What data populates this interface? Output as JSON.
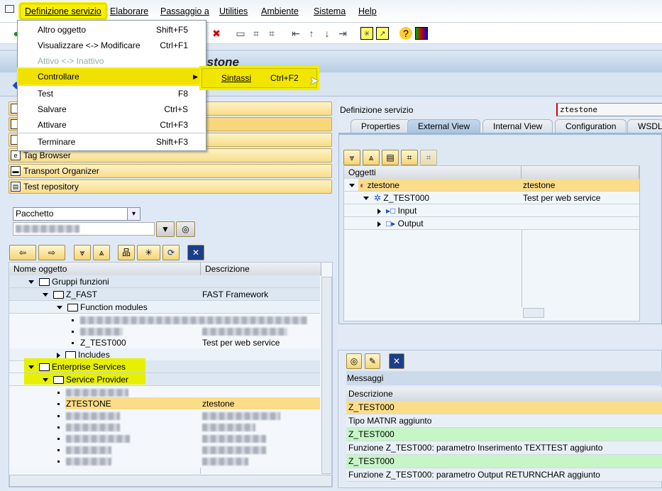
{
  "menubar": {
    "items": [
      "Definizione servizio",
      "Elaborare",
      "Passaggio a",
      "Utilities",
      "Ambiente",
      "Sistema",
      "Help"
    ]
  },
  "title": "ztestone",
  "dropdown": {
    "items": [
      {
        "label": "Altro oggetto",
        "shortcut": "Shift+F5",
        "enabled": true
      },
      {
        "label": "Visualizzare <-> Modificare",
        "shortcut": "Ctrl+F1",
        "enabled": true
      },
      {
        "label": "Attivo <-> Inattivo",
        "shortcut": "",
        "enabled": false
      },
      {
        "label": "Controllare",
        "shortcut": "",
        "enabled": true,
        "submenu": true
      },
      {
        "label": "Test",
        "shortcut": "F8",
        "enabled": true
      },
      {
        "label": "Salvare",
        "shortcut": "Ctrl+S",
        "enabled": true
      },
      {
        "label": "Attivare",
        "shortcut": "Ctrl+F3",
        "enabled": true
      },
      {
        "label": "Terminare",
        "shortcut": "Shift+F3",
        "enabled": true
      }
    ],
    "submenu": {
      "label": "Sintassi",
      "shortcut": "Ctrl+F2"
    }
  },
  "left": {
    "nav_buttons": [
      "Tag Browser",
      "Transport Organizer",
      "Test repository"
    ],
    "object_type": "Pacchetto",
    "tree_headers": [
      "Nome oggetto",
      "Descrizione"
    ],
    "tree": [
      {
        "name": "Gruppi funzioni",
        "desc": ""
      },
      {
        "name": "Z_FAST",
        "desc": "FAST Framework"
      },
      {
        "name": "Function modules",
        "desc": ""
      },
      {
        "name": "Z_TEST000",
        "desc": "Test per web service"
      },
      {
        "name": "Includes",
        "desc": ""
      },
      {
        "name": "Enterprise Services",
        "desc": ""
      },
      {
        "name": "Service Provider",
        "desc": ""
      },
      {
        "name": "ZTESTONE",
        "desc": "ztestone"
      }
    ]
  },
  "right": {
    "field_label": "Definizione servizio",
    "field_value": "ztestone",
    "tabs": [
      "Properties",
      "External View",
      "Internal View",
      "Configuration",
      "WSDL"
    ],
    "active_tab": "External View",
    "tree_header": "Oggetti",
    "tree": [
      {
        "name": "ztestone",
        "desc": "ztestone"
      },
      {
        "name": "Z_TEST000",
        "desc": "Test per web service"
      },
      {
        "name": "Input",
        "desc": ""
      },
      {
        "name": "Output",
        "desc": ""
      }
    ]
  },
  "messages": {
    "title": "Messaggi",
    "header": "Descrizione",
    "rows": [
      "Z_TEST000",
      "Tipo MATNR aggiunto",
      "Z_TEST000",
      "Funzione Z_TEST000: parametro Inserimento TEXTTEST aggiunto",
      "Z_TEST000",
      "Funzione Z_TEST000: parametro Output RETURNCHAR aggiunto"
    ]
  },
  "colors": {
    "highlight": "#f8f000",
    "selected_row": "#fbdc88",
    "success_row": "#c6f5c6"
  }
}
